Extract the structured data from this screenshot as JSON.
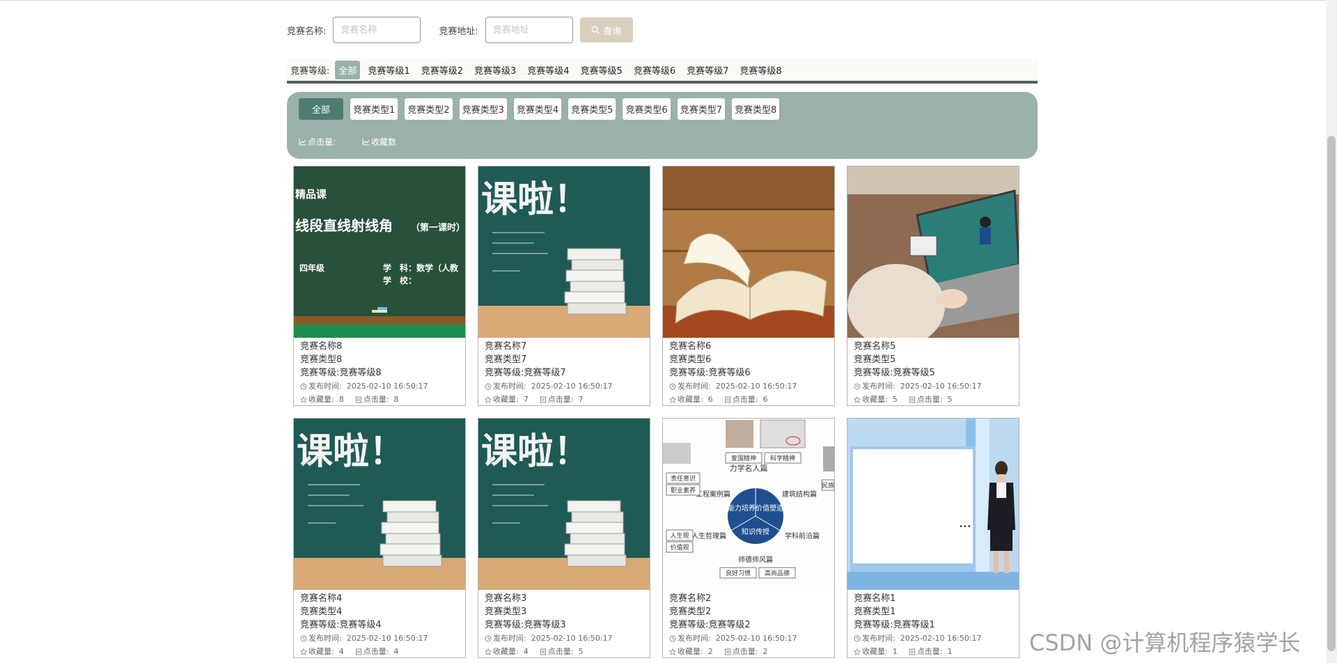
{
  "search": {
    "name_label": "竞赛名称:",
    "name_placeholder": "竞赛名称",
    "address_label": "竞赛地址:",
    "address_placeholder": "竞赛地址",
    "button_label": "查询"
  },
  "level_filter": {
    "label": "竞赛等级:",
    "items": [
      "全部",
      "竞赛等级1",
      "竞赛等级2",
      "竞赛等级3",
      "竞赛等级4",
      "竞赛等级5",
      "竞赛等级6",
      "竞赛等级7",
      "竞赛等级8"
    ],
    "active": "全部"
  },
  "type_filter": {
    "items": [
      "全部",
      "竞赛类型1",
      "竞赛类型2",
      "竞赛类型3",
      "竞赛类型4",
      "竞赛类型5",
      "竞赛类型6",
      "竞赛类型7",
      "竞赛类型8"
    ],
    "active": "全部"
  },
  "sort": {
    "clicks": "点击量:",
    "favorites": "收藏数"
  },
  "labels": {
    "publish": "发布时间:",
    "favorites": "收藏量:",
    "clicks": "点击量:"
  },
  "cards": [
    {
      "name": "竞赛名称8",
      "type": "竞赛类型8",
      "level": "竞赛等级:竞赛等级8",
      "time": "2025-02-10 16:50:17",
      "fav": "8",
      "clicks": "8",
      "image": "blackboard-lesson",
      "image_text": {
        "line1": "精品课",
        "line2": "线段直线射线角",
        "line2b": "（第一课时）",
        "grade": "四年级",
        "subject": "学　科：数学（人教",
        "school": "学　校："
      }
    },
    {
      "name": "竞赛名称7",
      "type": "竞赛类型7",
      "level": "竞赛等级:竞赛等级7",
      "time": "2025-02-10 16:50:17",
      "fav": "7",
      "clicks": "7",
      "image": "chalkboard-books",
      "image_text": {
        "headline": "课啦！"
      }
    },
    {
      "name": "竞赛名称6",
      "type": "竞赛类型6",
      "level": "竞赛等级:竞赛等级6",
      "time": "2025-02-10 16:50:17",
      "fav": "6",
      "clicks": "6",
      "image": "open-book"
    },
    {
      "name": "竞赛名称5",
      "type": "竞赛类型5",
      "level": "竞赛等级:竞赛等级5",
      "time": "2025-02-10 16:50:17",
      "fav": "5",
      "clicks": "5",
      "image": "laptop-online-class"
    },
    {
      "name": "竞赛名称4",
      "type": "竞赛类型4",
      "level": "竞赛等级:竞赛等级4",
      "time": "2025-02-10 16:50:17",
      "fav": "4",
      "clicks": "4",
      "image": "chalkboard-books",
      "image_text": {
        "headline": "课啦！"
      }
    },
    {
      "name": "竞赛名称3",
      "type": "竞赛类型3",
      "level": "竞赛等级:竞赛等级3",
      "time": "2025-02-10 16:50:17",
      "fav": "4",
      "clicks": "5",
      "image": "chalkboard-books",
      "image_text": {
        "headline": "课啦！"
      }
    },
    {
      "name": "竞赛名称2",
      "type": "竞赛类型2",
      "level": "竞赛等级:竞赛等级2",
      "time": "2025-02-10 16:50:17",
      "fav": "2",
      "clicks": "2",
      "image": "course-diagram",
      "image_text": {
        "top": "力学名人篇",
        "tl": "爱国精神",
        "tr": "科学精神",
        "center1": "能力培养",
        "center2": "价值塑造",
        "center3": "知识传授",
        "left1": "工程案例篇",
        "right1": "建筑结构篇",
        "left2": "人生哲理篇",
        "right2": "学科前沿篇",
        "bottom": "师德师风篇",
        "tag1": "责任意识",
        "tag2": "职业素养",
        "tag3": "人生观",
        "tag4": "价值观",
        "tag5": "良好习惯",
        "tag6": "高尚品德",
        "tag7": "民族"
      }
    },
    {
      "name": "竞赛名称1",
      "type": "竞赛类型1",
      "level": "竞赛等级:竞赛等级1",
      "time": "2025-02-10 16:50:17",
      "fav": "1",
      "clicks": "1",
      "image": "virtual-presenter"
    }
  ],
  "watermark": "CSDN @计算机程序猿学长"
}
